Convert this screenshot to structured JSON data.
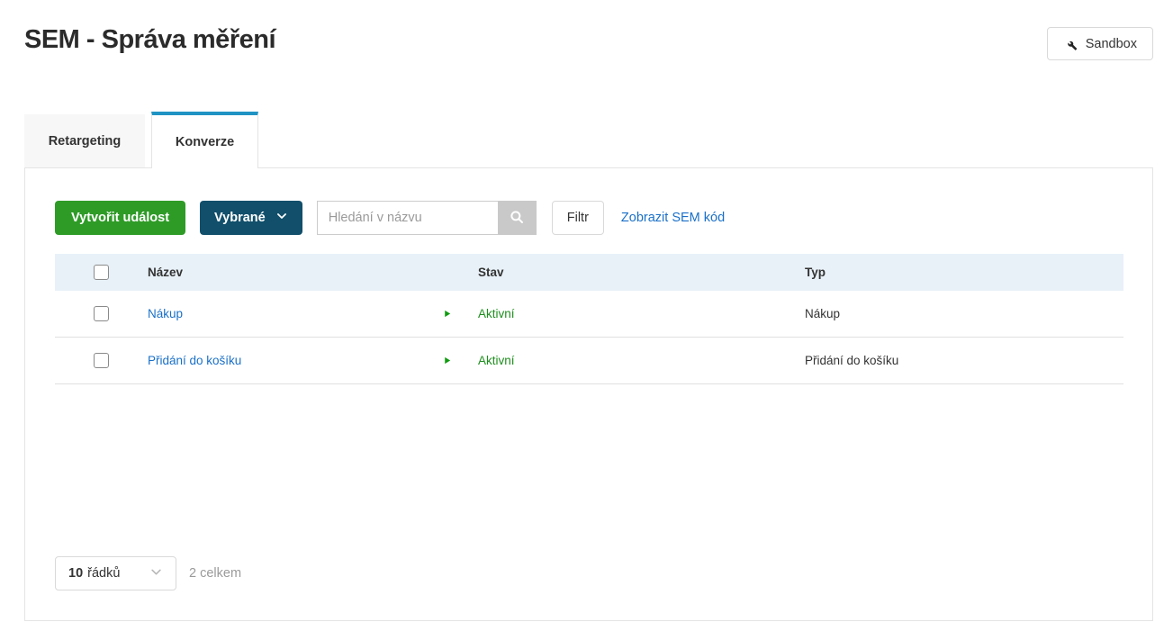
{
  "page": {
    "title": "SEM - Správa měření"
  },
  "header": {
    "sandbox_label": "Sandbox"
  },
  "tabs": [
    {
      "label": "Retargeting",
      "active": false
    },
    {
      "label": "Konverze",
      "active": true
    }
  ],
  "toolbar": {
    "create_button": "Vytvořit událost",
    "selected_dropdown": "Vybrané",
    "search_placeholder": "Hledání v názvu",
    "search_value": "",
    "filter_button": "Filtr",
    "show_code_link": "Zobrazit SEM kód"
  },
  "table": {
    "columns": [
      "Název",
      "Stav",
      "Typ"
    ],
    "rows": [
      {
        "name": "Nákup",
        "status": "Aktivní",
        "type": "Nákup"
      },
      {
        "name": "Přidání do košíku",
        "status": "Aktivní",
        "type": "Přidání do košíku"
      }
    ]
  },
  "pagination": {
    "rows_count": "10",
    "rows_label": "řádků",
    "total": "2 celkem"
  },
  "icons": {
    "sandbox": "wrench-icon",
    "selected_dropdown": "chevron-down-icon",
    "search": "search-icon",
    "status": "play-triangle-icon",
    "rows_select": "chevron-down-icon"
  },
  "colors": {
    "accent_blue": "#1f93c4",
    "link_blue": "#1a70c8",
    "green_button": "#2e9b27",
    "dark_button": "#114f6b",
    "status_green": "#1e8e1e",
    "header_row_bg": "#e8f1f8",
    "panel_border": "#e4e4e4"
  }
}
